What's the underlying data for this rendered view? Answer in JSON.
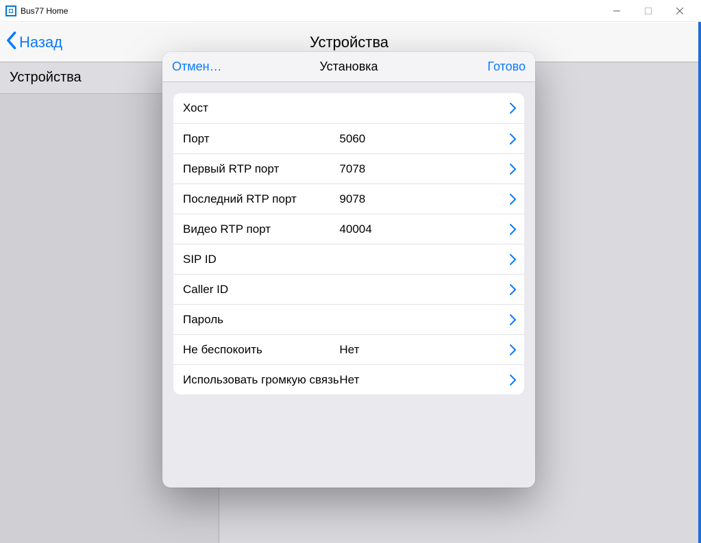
{
  "window": {
    "title": "Bus77 Home"
  },
  "navbar": {
    "back_label": "Назад",
    "title": "Устройства"
  },
  "sidebar": {
    "row_label": "Устройства"
  },
  "modal": {
    "cancel_label": "Отмен…",
    "title": "Установка",
    "done_label": "Готово",
    "rows": [
      {
        "label": "Хост",
        "value": ""
      },
      {
        "label": "Порт",
        "value": "5060"
      },
      {
        "label": "Первый RTP порт",
        "value": "7078"
      },
      {
        "label": "Последний RTP порт",
        "value": "9078"
      },
      {
        "label": "Видео RTP порт",
        "value": "40004"
      },
      {
        "label": "SIP ID",
        "value": ""
      },
      {
        "label": "Caller ID",
        "value": ""
      },
      {
        "label": "Пароль",
        "value": ""
      },
      {
        "label": "Не беспокоить",
        "value": "Нет"
      },
      {
        "label": "Использовать громкую связь",
        "value": "Нет"
      }
    ]
  }
}
